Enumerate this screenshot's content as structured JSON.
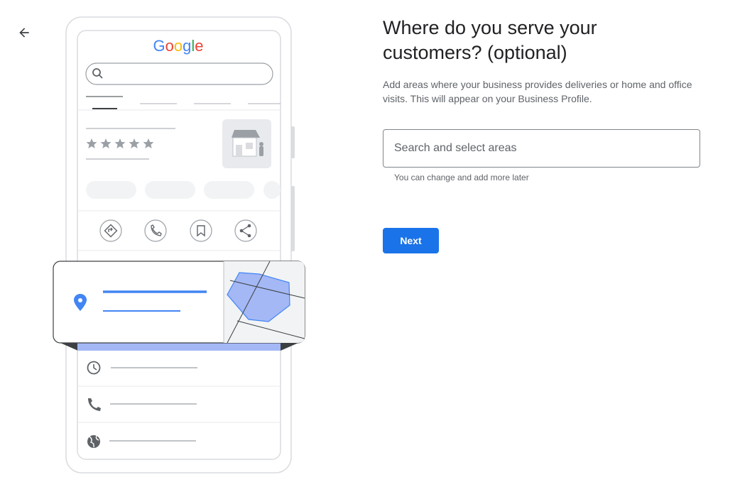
{
  "nav": {
    "back_icon": "arrow-back-icon"
  },
  "illustration": {
    "logo_text": "Google",
    "logo_colors": [
      "#4285F4",
      "#EA4335",
      "#FBBC05",
      "#4285F4",
      "#34A853",
      "#EA4335"
    ],
    "rating_stars": 5,
    "action_icons": [
      "directions-icon",
      "phone-icon",
      "bookmark-icon",
      "share-icon"
    ],
    "info_icons": [
      "clock-icon",
      "phone-icon",
      "globe-icon"
    ],
    "accent_color": "#4285F4",
    "area_fill": "#a4b8f5"
  },
  "page": {
    "heading": "Where do you serve your customers? (optional)",
    "description": "Add areas where your business provides deliveries or home and office visits. This will appear on your Business Profile."
  },
  "search": {
    "placeholder": "Search and select areas",
    "value": "",
    "helper": "You can change and add more later"
  },
  "actions": {
    "next_label": "Next"
  },
  "colors": {
    "primary": "#1a73e8",
    "text": "#202124",
    "secondary_text": "#5f6368",
    "border": "#80868b"
  }
}
